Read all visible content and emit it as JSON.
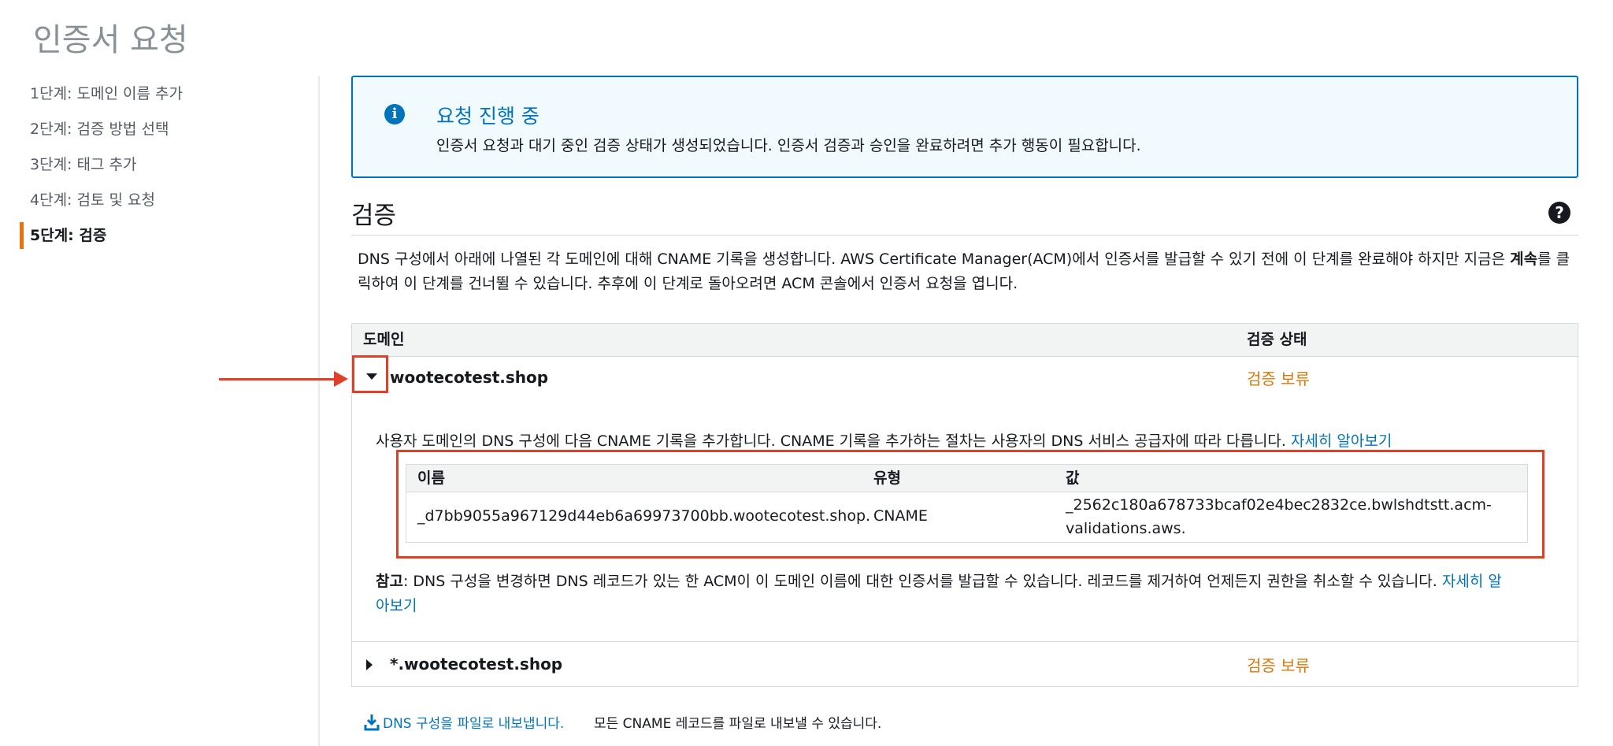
{
  "page": {
    "title": "인증서 요청"
  },
  "steps": [
    {
      "label": "1단계: 도메인 이름 추가"
    },
    {
      "label": "2단계: 검증 방법 선택"
    },
    {
      "label": "3단계: 태그 추가"
    },
    {
      "label": "4단계: 검토 및 요청"
    },
    {
      "label": "5단계: 검증"
    }
  ],
  "flash": {
    "title": "요청 진행 중",
    "message": "인증서 요청과 대기 중인 검증 상태가 생성되었습니다. 인증서 검증과 승인을 완료하려면 추가 행동이 필요합니다.",
    "icon": "info-icon"
  },
  "validation": {
    "title": "검증",
    "description_1": "DNS 구성에서 아래에 나열된 각 도메인에 대해 CNAME 기록을 생성합니다. AWS Certificate Manager(ACM)에서 인증서를 발급할 수 있기 전에 이 단계를 완료해야 하지만 지금은 ",
    "description_bold": "계속",
    "description_2": "를 클릭하여 이 단계를 건너뛸 수 있습니다. 추후에 이 단계로 돌아오려면 ACM 콘솔에서 인증서 요청을 엽니다."
  },
  "table": {
    "headers": {
      "domain": "도메인",
      "status": "검증 상태"
    },
    "rows": [
      {
        "domain": "wootecotest.shop",
        "status": "검증 보류",
        "detail": "사용자 도메인의 DNS 구성에 다음 CNAME 기록을 추가합니다. CNAME 기록을 추가하는 절차는 사용자의 DNS 서비스 공급자에 따라 다릅니다. ",
        "detail_link": "자세히 알아보기",
        "records_headers": {
          "name": "이름",
          "type": "유형",
          "value": "값"
        },
        "record": {
          "name": "_d7bb9055a967129d44eb6a69973700bb.wootecotest.shop.",
          "type": "CNAME",
          "value_line1": "_2562c180a678733bcaf02e4bec2832ce.bwlshdtstt.acm-",
          "value_line2": "validations.aws."
        },
        "note_label": "참고",
        "note_text": ": DNS 구성을 변경하면 DNS 레코드가 있는 한 ACM이 이 도메인 이름에 대한 인증서를 발급할 수 있습니다. 레코드를 제거하여 언제든지 권한을 취소할 수 있습니다. ",
        "note_link_1": "자세히 알",
        "note_link_2": "아보기"
      },
      {
        "domain": "*.wootecotest.shop",
        "status": "검증 보류"
      }
    ]
  },
  "export": {
    "link": "DNS 구성을 파일로 내보냅니다.",
    "description": "모든 CNAME 레코드를 파일로 내보낼 수 있습니다."
  },
  "colors": {
    "accent": "#0073bb",
    "warning": "#d6790c",
    "annotation": "#e0402a",
    "active_step": "#ec7211"
  }
}
